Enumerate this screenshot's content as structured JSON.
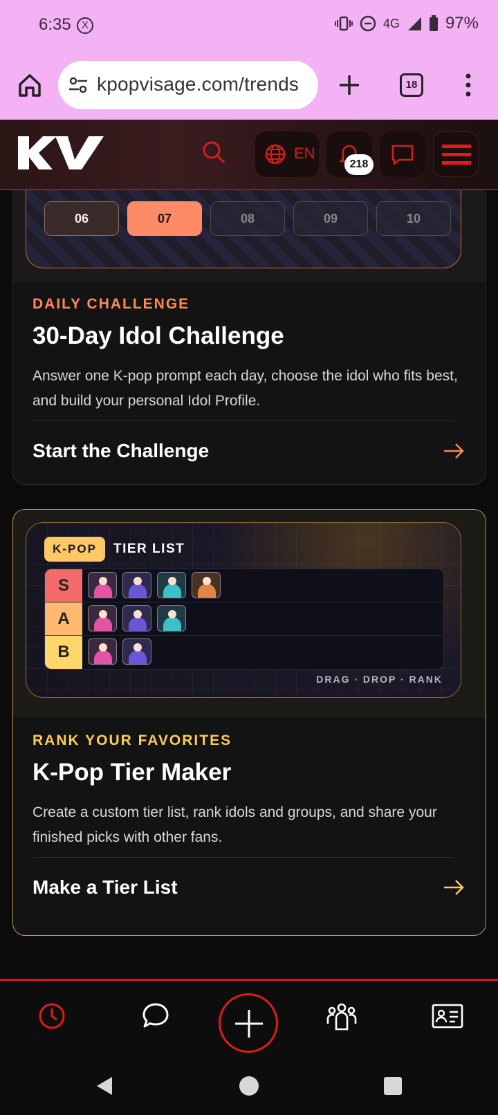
{
  "status_bar": {
    "time": "6:35",
    "x_badge": "X",
    "network": "4G",
    "battery": "97%"
  },
  "browser": {
    "url": "kpopvisage.com/trends",
    "tab_count": "18"
  },
  "site_header": {
    "lang": "EN",
    "notification_count": "218"
  },
  "challenge_card": {
    "calendar_days": [
      {
        "label": "06",
        "state": "past"
      },
      {
        "label": "07",
        "state": "today"
      },
      {
        "label": "08",
        "state": "future"
      },
      {
        "label": "09",
        "state": "future"
      },
      {
        "label": "10",
        "state": "future"
      }
    ],
    "eyebrow": "DAILY CHALLENGE",
    "title": "30-Day Idol Challenge",
    "description": "Answer one K-pop prompt each day, choose the idol who fits best, and build your personal Idol Profile.",
    "cta": "Start the Challenge",
    "accent": "#ff8a5c"
  },
  "tier_card": {
    "badge": "K-POP",
    "label": "TIER LIST",
    "tiers": [
      {
        "key": "S",
        "color": "#f36b6b",
        "chips": [
          "#e255a5",
          "#6a56d8",
          "#3cc1c8",
          "#e38447"
        ]
      },
      {
        "key": "A",
        "color": "#ffb870",
        "chips": [
          "#e255a5",
          "#6a56d8",
          "#3cc1c8"
        ]
      },
      {
        "key": "B",
        "color": "#ffd66b",
        "chips": [
          "#e255a5",
          "#6a56d8"
        ]
      }
    ],
    "tagline": "DRAG · DROP · RANK",
    "eyebrow": "RANK YOUR FAVORITES",
    "title": "K-Pop Tier Maker",
    "description": "Create a custom tier list, rank idols and groups, and share your finished picks with other fans.",
    "cta": "Make a Tier List",
    "accent": "#ffcc55"
  },
  "bottom_nav": {
    "items": [
      "history-icon",
      "chat-bubble-icon",
      "plus-icon",
      "community-icon",
      "profile-card-icon"
    ]
  }
}
